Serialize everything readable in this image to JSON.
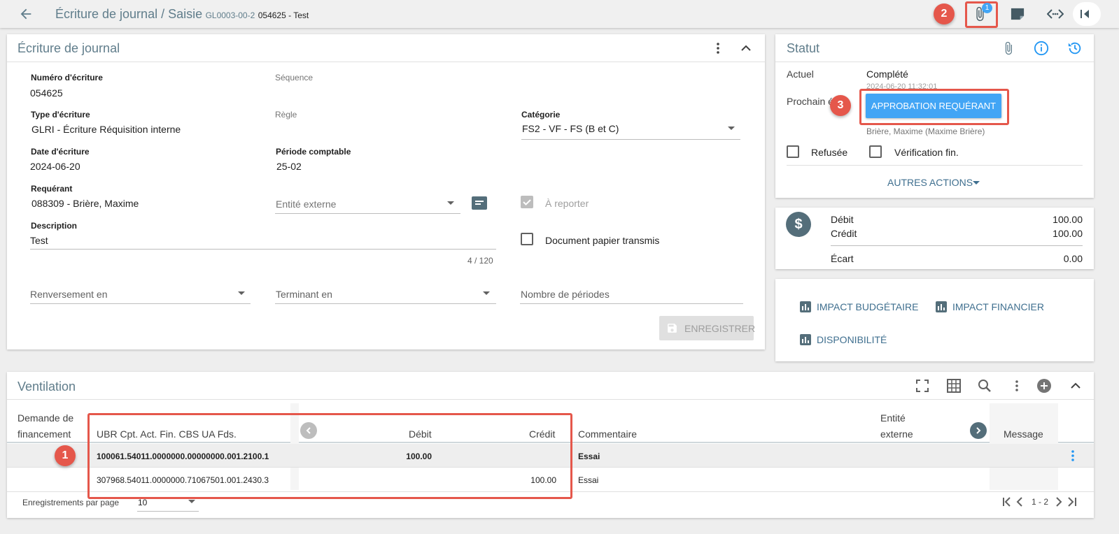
{
  "header": {
    "title": "Écriture de journal / Saisie",
    "code": "GL0003-00-2",
    "ref": "054625 - Test",
    "badge_count": "1"
  },
  "journal": {
    "title": "Écriture de journal",
    "numero_label": "Numéro d'écriture",
    "numero_value": "054625",
    "sequence_label": "Séquence",
    "type_label": "Type d'écriture",
    "type_value": "GLRI - Écriture Réquisition interne",
    "regle_label": "Règle",
    "categorie_label": "Catégorie",
    "categorie_value": "FS2 - VF - FS (B et C)",
    "date_label": "Date d'écriture",
    "date_value": "2024-06-20",
    "periode_label": "Période comptable",
    "periode_value": "25-02",
    "requerant_label": "Requérant",
    "requerant_value": "088309 - Brière, Maxime",
    "entite_placeholder": "Entité externe",
    "a_reporter_label": "À reporter",
    "description_label": "Description",
    "description_value": "Test",
    "char_count": "4 / 120",
    "document_label": "Document papier transmis",
    "renversement_placeholder": "Renversement en",
    "terminant_placeholder": "Terminant en",
    "nombre_placeholder": "Nombre de périodes",
    "save_label": "ENREGISTRER"
  },
  "statut": {
    "title": "Statut",
    "actuel_label": "Actuel",
    "actuel_value": "Complété",
    "actuel_date": "2024-06-20 11:32:01",
    "prochain_label": "Prochain é",
    "approval_button": "APPROBATION REQUÉRANT",
    "approver": "Brière, Maxime (Maxime Brière)",
    "refusee_label": "Refusée",
    "verification_label": "Vérification fin.",
    "autres_actions": "AUTRES ACTIONS"
  },
  "totals": {
    "debit_label": "Débit",
    "debit_value": "100.00",
    "credit_label": "Crédit",
    "credit_value": "100.00",
    "ecart_label": "Écart",
    "ecart_value": "0.00"
  },
  "impact": {
    "budgetaire": "IMPACT BUDGÉTAIRE",
    "financier": "IMPACT FINANCIER",
    "disponibilite": "DISPONIBILITÉ"
  },
  "ventilation": {
    "title": "Ventilation",
    "col_demande_1": "Demande de",
    "col_demande_2": "financement",
    "col_ubr": "UBR Cpt. Act. Fin. CBS UA Fds.",
    "col_debit": "Débit",
    "col_credit": "Crédit",
    "col_commentaire": "Commentaire",
    "col_entite_1": "Entité",
    "col_entite_2": "externe",
    "col_message": "Message",
    "rows": [
      {
        "ubr": "100061.54011.0000000.00000000.001.2100.1",
        "debit": "100.00",
        "credit": "",
        "commentaire": "Essai"
      },
      {
        "ubr": "307968.54011.0000000.71067501.001.2430.3",
        "debit": "",
        "credit": "100.00",
        "commentaire": "Essai"
      }
    ],
    "per_page_label": "Enregistrements par page",
    "per_page_value": "10",
    "range": "1 - 2"
  },
  "annotations": {
    "one": "1",
    "two": "2",
    "three": "3"
  },
  "colors": {
    "accent": "#42a5f5",
    "annotation": "#e5574b",
    "title": "#607d8b"
  }
}
